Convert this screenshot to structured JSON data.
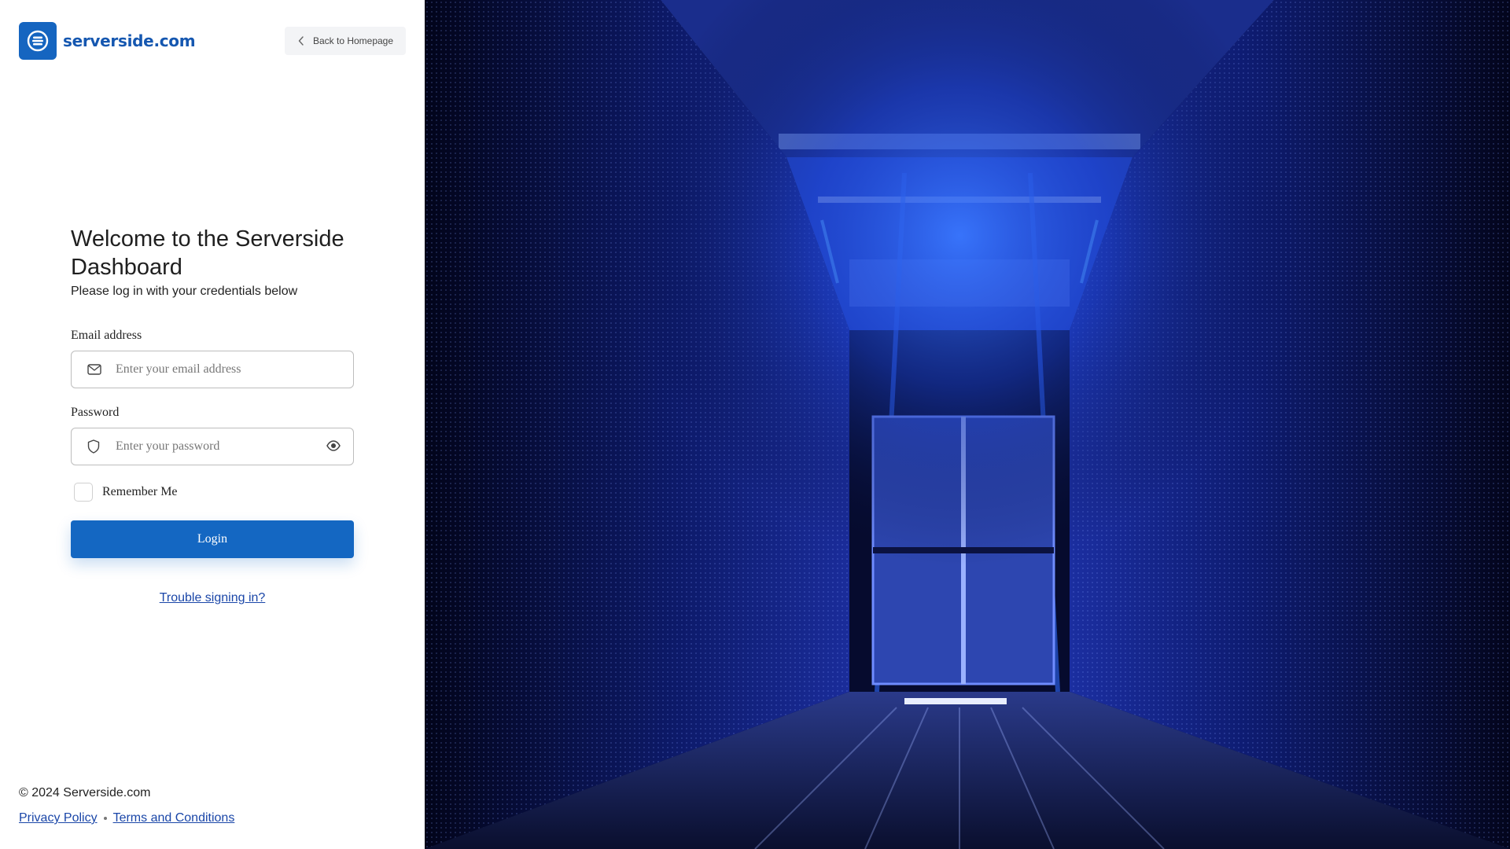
{
  "brand": {
    "name": "serverside.com",
    "icon": "server-stack-icon"
  },
  "header": {
    "back_label": "Back to Homepage",
    "back_icon": "chevron-left-icon"
  },
  "login": {
    "title": "Welcome to the Serverside Dashboard",
    "subtitle": "Please log in with your credentials below",
    "email": {
      "label": "Email address",
      "placeholder": "Enter your email address",
      "value": "",
      "icon": "envelope-icon"
    },
    "password": {
      "label": "Password",
      "placeholder": "Enter your password",
      "value": "",
      "icon": "shield-icon",
      "toggle_icon": "eye-icon"
    },
    "remember": {
      "label": "Remember Me",
      "checked": false
    },
    "submit_label": "Login",
    "trouble_label": "Trouble signing in?"
  },
  "footer": {
    "copyright": "© 2024 Serverside.com",
    "links": [
      "Privacy Policy",
      "Terms and Conditions"
    ]
  },
  "colors": {
    "accent": "#1467c2",
    "brand_text": "#1557b0",
    "link": "#1a46a8"
  }
}
